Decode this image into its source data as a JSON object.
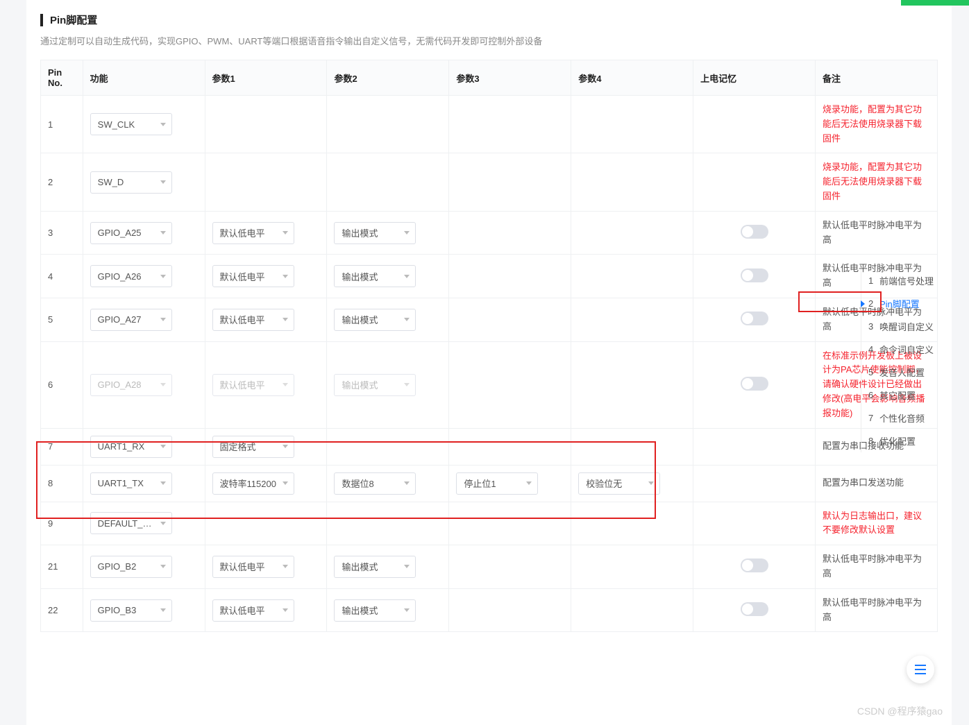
{
  "section": {
    "title": "Pin脚配置",
    "subtitle": "通过定制可以自动生成代码，实现GPIO、PWM、UART等端口根据语音指令输出自定义信号，无需代码开发即可控制外部设备"
  },
  "columns": {
    "pinno": "Pin No.",
    "func": "功能",
    "p1": "参数1",
    "p2": "参数2",
    "p3": "参数3",
    "p4": "参数4",
    "mem": "上电记忆",
    "note": "备注"
  },
  "rows": [
    {
      "no": "1",
      "func": "SW_CLK",
      "p1": "",
      "p2": "",
      "p3": "",
      "p4": "",
      "mem": "",
      "note": "烧录功能，配置为其它功能后无法使用烧录器下载固件",
      "note_red": true,
      "disabled": false
    },
    {
      "no": "2",
      "func": "SW_D",
      "p1": "",
      "p2": "",
      "p3": "",
      "p4": "",
      "mem": "",
      "note": "烧录功能，配置为其它功能后无法使用烧录器下载固件",
      "note_red": true,
      "disabled": false
    },
    {
      "no": "3",
      "func": "GPIO_A25",
      "p1": "默认低电平",
      "p2": "输出模式",
      "p3": "",
      "p4": "",
      "mem": "toggle",
      "note": "默认低电平时脉冲电平为高",
      "note_red": false,
      "disabled": false
    },
    {
      "no": "4",
      "func": "GPIO_A26",
      "p1": "默认低电平",
      "p2": "输出模式",
      "p3": "",
      "p4": "",
      "mem": "toggle",
      "note": "默认低电平时脉冲电平为高",
      "note_red": false,
      "disabled": false
    },
    {
      "no": "5",
      "func": "GPIO_A27",
      "p1": "默认低电平",
      "p2": "输出模式",
      "p3": "",
      "p4": "",
      "mem": "toggle",
      "note": "默认低电平时脉冲电平为高",
      "note_red": false,
      "disabled": false
    },
    {
      "no": "6",
      "func": "GPIO_A28",
      "p1": "默认低电平",
      "p2": "输出模式",
      "p3": "",
      "p4": "",
      "mem": "toggle",
      "note": "在标准示例开发板上被设计为PA芯片使能控制脚，请确认硬件设计已经做出修改(高电平会影响音频播报功能)",
      "note_red": true,
      "disabled": true
    },
    {
      "no": "7",
      "func": "UART1_RX",
      "p1": "固定格式",
      "p2": "",
      "p3": "",
      "p4": "",
      "mem": "",
      "note": "配置为串口接收功能",
      "note_red": false,
      "disabled": false
    },
    {
      "no": "8",
      "func": "UART1_TX",
      "p1": "波特率115200",
      "p2": "数据位8",
      "p3": "停止位1",
      "p4": "校验位无",
      "mem": "",
      "note": "配置为串口发送功能",
      "note_red": false,
      "disabled": false
    },
    {
      "no": "9",
      "func": "DEFAULT_LOG",
      "p1": "",
      "p2": "",
      "p3": "",
      "p4": "",
      "mem": "",
      "note": "默认为日志输出口，建议不要修改默认设置",
      "note_red": true,
      "disabled": false
    },
    {
      "no": "21",
      "func": "GPIO_B2",
      "p1": "默认低电平",
      "p2": "输出模式",
      "p3": "",
      "p4": "",
      "mem": "toggle",
      "note": "默认低电平时脉冲电平为高",
      "note_red": false,
      "disabled": false
    },
    {
      "no": "22",
      "func": "GPIO_B3",
      "p1": "默认低电平",
      "p2": "输出模式",
      "p3": "",
      "p4": "",
      "mem": "toggle",
      "note": "默认低电平时脉冲电平为高",
      "note_red": false,
      "disabled": false
    }
  ],
  "nav": [
    {
      "idx": "1",
      "label": "前端信号处理",
      "active": false
    },
    {
      "idx": "2",
      "label": "Pin脚配置",
      "active": true
    },
    {
      "idx": "3",
      "label": "唤醒词自定义",
      "active": false
    },
    {
      "idx": "4",
      "label": "命令词自定义",
      "active": false
    },
    {
      "idx": "5",
      "label": "发音人配置",
      "active": false
    },
    {
      "idx": "6",
      "label": "其它配置",
      "active": false
    },
    {
      "idx": "7",
      "label": "个性化音频",
      "active": false
    },
    {
      "idx": "8",
      "label": "优化配置",
      "active": false
    }
  ],
  "watermark": "CSDN @程序猿gao"
}
